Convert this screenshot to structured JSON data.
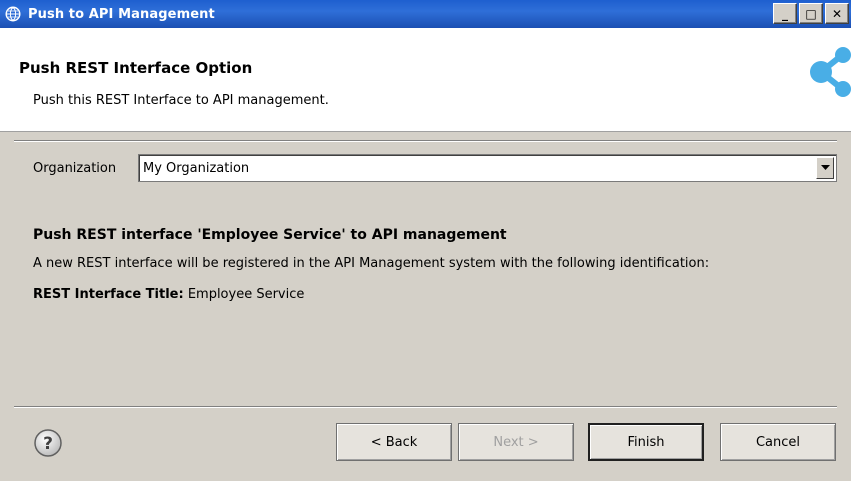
{
  "window": {
    "title": "Push to API Management",
    "controls": {
      "minimize": "_",
      "maximize": "□",
      "close": "✕"
    }
  },
  "header": {
    "title": "Push REST Interface Option",
    "description": "Push this REST Interface to API management.",
    "logo_icon": "share-nodes-icon",
    "logo_color": "#49aee6"
  },
  "organization": {
    "label": "Organization",
    "selected": "My Organization"
  },
  "details": {
    "heading": "Push REST interface  'Employee Service'  to API management",
    "description": "A new REST interface will be registered in the API Management system with the following identification:",
    "title_label": "REST Interface Title:",
    "title_value": "Employee Service"
  },
  "buttons": {
    "back": "< Back",
    "next": "Next >",
    "finish": "Finish",
    "cancel": "Cancel"
  },
  "icons": {
    "window_icon": "globe-icon",
    "help_icon": "help-icon"
  }
}
